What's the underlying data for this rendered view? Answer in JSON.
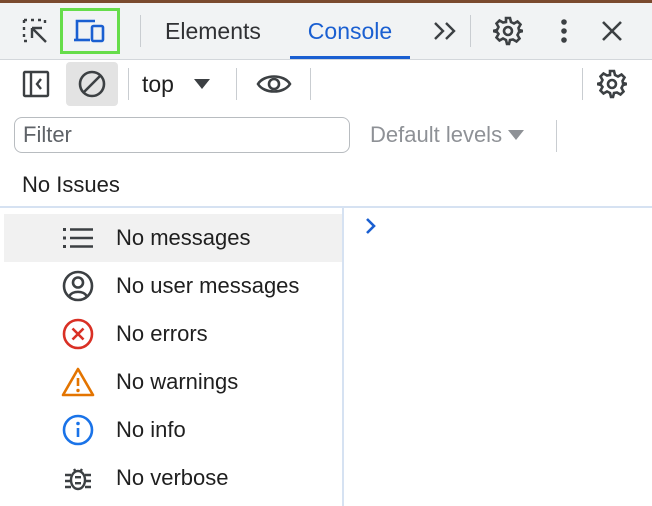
{
  "tabs": {
    "elements": "Elements",
    "console": "Console"
  },
  "toolbar": {
    "context": "top"
  },
  "filter": {
    "placeholder": "Filter",
    "levels": "Default levels"
  },
  "issues": {
    "text": "No Issues"
  },
  "sidebar": {
    "items": [
      {
        "label": "No messages",
        "icon": "list-icon",
        "selected": true
      },
      {
        "label": "No user messages",
        "icon": "user-icon"
      },
      {
        "label": "No errors",
        "icon": "error-icon",
        "color": "#d93025"
      },
      {
        "label": "No warnings",
        "icon": "warning-icon",
        "color": "#e37400"
      },
      {
        "label": "No info",
        "icon": "info-icon",
        "color": "#1a73e8"
      },
      {
        "label": "No verbose",
        "icon": "bug-icon"
      }
    ]
  },
  "colors": {
    "accent": "#1a5fd1",
    "device_highlight": "#66dd4a"
  }
}
